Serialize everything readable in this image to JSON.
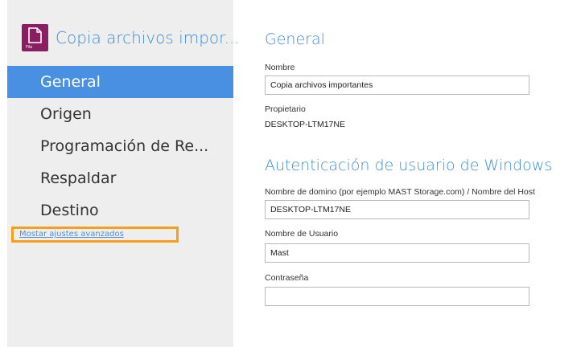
{
  "app": {
    "title": "Copia archivos impor...",
    "icon_tag": "File"
  },
  "nav": {
    "items": [
      {
        "label": "General"
      },
      {
        "label": "Origen"
      },
      {
        "label": "Programación de Re..."
      },
      {
        "label": "Respaldar"
      },
      {
        "label": "Destino"
      }
    ],
    "advanced_link": "Mostar ajustes avanzados"
  },
  "general": {
    "title": "General",
    "name_label": "Nombre",
    "name_value": "Copia archivos importantes",
    "owner_label": "Propietario",
    "owner_value": "DESKTOP-LTM17NE"
  },
  "auth": {
    "title": "Autenticación de usuario de Windows",
    "domain_label": "Nombre de domino (por ejemplo MAST Storage.com) / Nombre del Host",
    "domain_value": "DESKTOP-LTM17NE",
    "user_label": "Nombre de Usuario",
    "user_value": "Mast",
    "password_label": "Contraseña",
    "password_value": ""
  },
  "colors": {
    "accent": "#4a90e2",
    "icon_bg": "#8a1e63",
    "highlight_box": "#f5a01a"
  }
}
